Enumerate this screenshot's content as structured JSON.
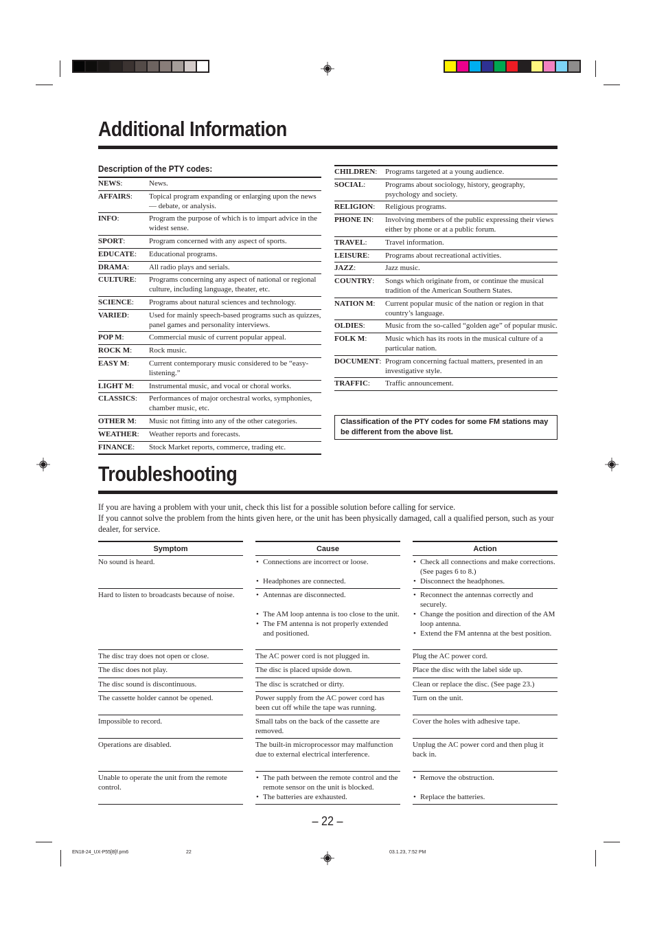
{
  "print_marks": {
    "gray_swatches": [
      "#050505",
      "#0e0d0c",
      "#1a1716",
      "#282321",
      "#3b3331",
      "#544b48",
      "#6d6360",
      "#887d79",
      "#a59d99",
      "#d3cbc9",
      "#ffffff"
    ],
    "color_swatches": [
      "#fff200",
      "#ec008c",
      "#00aeef",
      "#2e3192",
      "#00a651",
      "#ed1c24",
      "#231f20",
      "#fff77f",
      "#f282c1",
      "#7dd4f7",
      "#8e8c8c"
    ]
  },
  "additional_info": {
    "title": "Additional Information",
    "subtitle": "Description of the PTY codes:",
    "left_codes": [
      {
        "code": "NEWS",
        "desc": "News."
      },
      {
        "code": "AFFAIRS",
        "desc": "Topical program expanding or enlarging upon the news — debate, or analysis."
      },
      {
        "code": "INFO",
        "desc": "Program the purpose of which is to impart advice in the widest sense."
      },
      {
        "code": "SPORT",
        "desc": "Program concerned with any aspect of sports."
      },
      {
        "code": "EDUCATE",
        "desc": "Educational programs."
      },
      {
        "code": "DRAMA",
        "desc": "All radio plays and serials."
      },
      {
        "code": "CULTURE",
        "desc": "Programs concerning any aspect of national or regional culture, including language, theater, etc."
      },
      {
        "code": "SCIENCE",
        "desc": "Programs about natural sciences and technology."
      },
      {
        "code": "VARIED",
        "desc": "Used for mainly speech-based programs such as quizzes, panel games and personality interviews."
      },
      {
        "code": "POP M",
        "desc": "Commercial music of current popular appeal."
      },
      {
        "code": "ROCK M",
        "desc": "Rock music."
      },
      {
        "code": "EASY M",
        "desc": "Current contemporary music considered to be “easy-listening.”"
      },
      {
        "code": "LIGHT M",
        "desc": "Instrumental music, and vocal or choral works."
      },
      {
        "code": "CLASSICS",
        "desc": "Performances of major orchestral works, symphonies, chamber music, etc."
      },
      {
        "code": "OTHER M",
        "desc": "Music not fitting into any of the other categories."
      },
      {
        "code": "WEATHER",
        "desc": "Weather reports and forecasts."
      },
      {
        "code": "FINANCE",
        "desc": "Stock Market reports, commerce, trading etc."
      }
    ],
    "right_codes": [
      {
        "code": "CHILDREN",
        "desc": "Programs targeted at a young audience."
      },
      {
        "code": "SOCIAL",
        "desc": "Programs about sociology, history, geography, psychology and society."
      },
      {
        "code": "RELIGION",
        "desc": "Religious programs."
      },
      {
        "code": "PHONE IN",
        "desc": "Involving members of the public expressing their views either by phone or at a public forum."
      },
      {
        "code": "TRAVEL",
        "desc": "Travel information."
      },
      {
        "code": "LEISURE",
        "desc": "Programs about recreational activities."
      },
      {
        "code": "JAZZ",
        "desc": "Jazz music."
      },
      {
        "code": "COUNTRY",
        "desc": "Songs which originate from, or continue the musical tradition of the American Southern States."
      },
      {
        "code": "NATION M",
        "desc": "Current popular music of the nation or region in that country’s language."
      },
      {
        "code": "OLDIES",
        "desc": "Music from the so-called “golden age” of popular music."
      },
      {
        "code": "FOLK M",
        "desc": "Music which has its roots in the musical culture of a particular nation."
      },
      {
        "code": "DOCUMENT",
        "desc": "Program concerning factual matters, presented in an investigative style."
      },
      {
        "code": "TRAFFIC",
        "desc": "Traffic announcement."
      }
    ],
    "note": "Classification of the PTY codes for some FM stations may be different from the above list."
  },
  "troubleshooting": {
    "title": "Troubleshooting",
    "intro_1": "If you are having a problem with your unit, check this list for a possible solution before calling for service.",
    "intro_2": "If you cannot solve the problem from the hints given here, or the unit has been physically damaged, call a qualified person, such as your dealer, for service.",
    "headers": {
      "symptom": "Symptom",
      "cause": "Cause",
      "action": "Action"
    },
    "rows": [
      {
        "symptom": "No sound is heard.",
        "causes": [
          "Connections are incorrect or loose.",
          "Headphones are connected."
        ],
        "actions": [
          "Check all connections and make corrections. (See pages 6 to 8.)",
          "Disconnect the headphones."
        ]
      },
      {
        "symptom": "Hard to listen to broadcasts because of noise.",
        "causes": [
          "Antennas are disconnected.",
          "The AM loop antenna is too close to the unit.",
          "The FM antenna is not properly extended and positioned."
        ],
        "actions": [
          "Reconnect the antennas correctly and securely.",
          "Change the position and direction of the AM loop antenna.",
          "Extend the FM antenna at the best position."
        ]
      },
      {
        "symptom": "The disc tray does not open or close.",
        "cause": "The AC power cord is not plugged in.",
        "action": "Plug the AC power cord."
      },
      {
        "symptom": "The disc does not play.",
        "cause": "The disc is placed upside down.",
        "action": "Place the disc with the label side up."
      },
      {
        "symptom": "The disc sound is discontinuous.",
        "cause": "The disc is scratched or dirty.",
        "action": "Clean or replace the disc. (See page 23.)"
      },
      {
        "symptom": "The cassette holder cannot be opened.",
        "cause": "Power supply from the AC power cord has been cut off while the tape was running.",
        "action": "Turn on the unit."
      },
      {
        "symptom": "Impossible to record.",
        "cause": "Small tabs on the back of the cassette are removed.",
        "action": "Cover the holes with adhesive tape."
      },
      {
        "symptom": "Operations are disabled.",
        "cause": "The built-in microprocessor may malfunction due to external electrical interference.",
        "action": "Unplug the AC power cord and then plug it back in."
      },
      {
        "symptom": "Unable to operate the unit from the remote control.",
        "causes": [
          "The path between the remote control and the remote sensor on the unit is blocked.",
          "The batteries are exhausted."
        ],
        "actions": [
          "Remove the obstruction.",
          "Replace the batteries."
        ]
      }
    ]
  },
  "page_number": "– 22 –",
  "footer": {
    "file": "EN18-24_UX-P55[B]f.pm6",
    "page": "22",
    "datetime": "03.1.23, 7:52 PM"
  }
}
